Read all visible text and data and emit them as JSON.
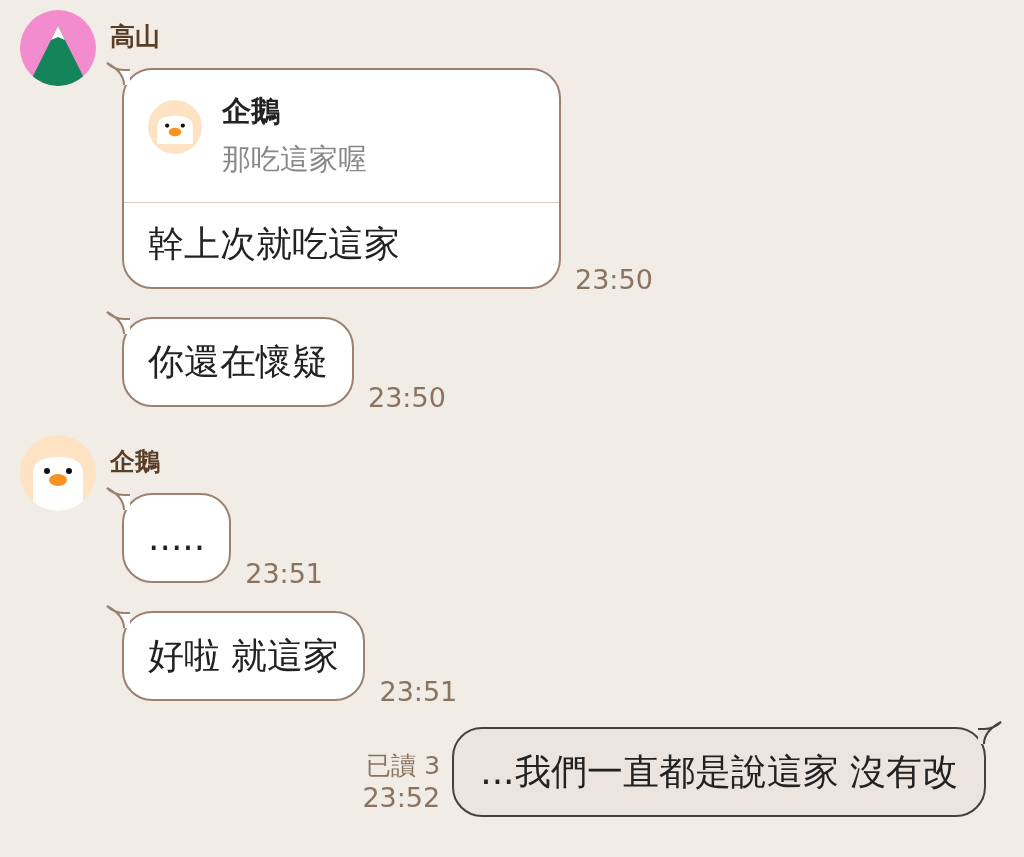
{
  "groups": [
    {
      "sender": {
        "name": "高山",
        "kind": "mountain"
      },
      "messages": [
        {
          "text": "幹上次就吃這家",
          "time": "23:50",
          "reply": {
            "name": "企鵝",
            "kind": "penguin",
            "text": "那吃這家喔"
          }
        },
        {
          "text": "你還在懷疑",
          "time": "23:50"
        }
      ]
    },
    {
      "sender": {
        "name": "企鵝",
        "kind": "penguin"
      },
      "messages": [
        {
          "text": ".....",
          "time": "23:51"
        },
        {
          "text": "好啦 就這家",
          "time": "23:51"
        }
      ]
    }
  ],
  "outgoing": [
    {
      "text": "...我們一直都是說這家 沒有改",
      "read": "已讀 3",
      "time": "23:52"
    }
  ]
}
